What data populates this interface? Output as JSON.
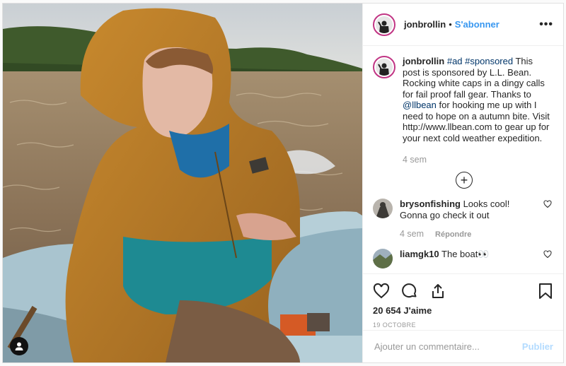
{
  "post": {
    "username": "jonbrollin",
    "follow_label": "S'abonner",
    "separator": "•",
    "more_label": "•••"
  },
  "caption": {
    "username": "jonbrollin",
    "hashtags": "#ad #sponsored",
    "text_part1": " This post is sponsored by L.L. Bean. Rocking white caps in a dingy calls for fail proof fall gear. Thanks to ",
    "mention": "@llbean",
    "text_part2": " for hooking me up with I need to hope on a autumn bite. Visit http://www.llbean.com to gear up for your next cold weather expedition.",
    "time": "4 sem"
  },
  "load_more_label": "+",
  "comments": [
    {
      "username": "brysonfishing",
      "text": "Looks cool! Gonna go check it out",
      "time": "4 sem",
      "reply_label": "Répondre"
    },
    {
      "username": "liamgk10",
      "text": "The boat👀"
    }
  ],
  "likes": "20 654 J'aime",
  "date": "19 OCTOBRE",
  "add_comment": {
    "placeholder": "Ajouter un commentaire...",
    "publish_label": "Publier"
  },
  "icons": [
    "user-tag-icon",
    "more-icon",
    "heart-icon",
    "comment-icon",
    "share-icon",
    "bookmark-icon",
    "add-circle-icon"
  ],
  "colors": {
    "link": "#3897f0",
    "follow": "#3897f0",
    "avatar_ring": "#c13584",
    "publish_disabled": "#b3dbff"
  }
}
